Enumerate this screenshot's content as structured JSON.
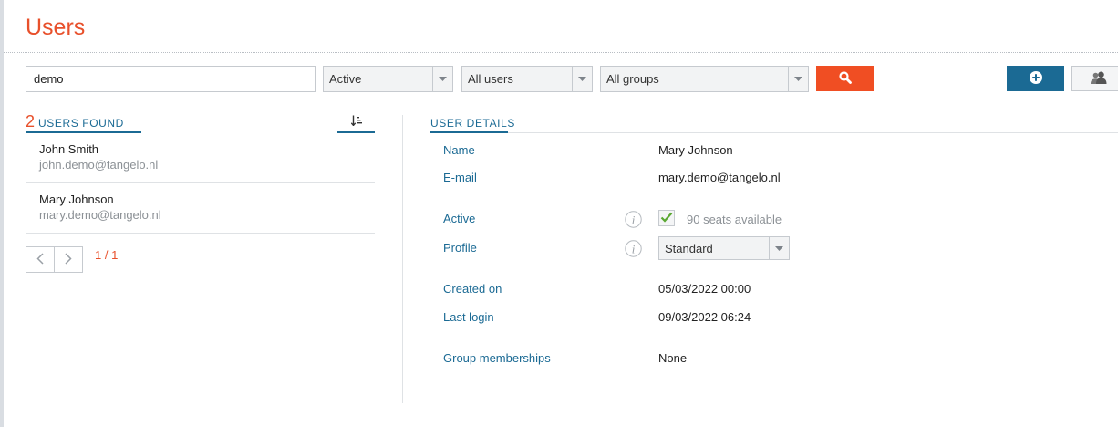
{
  "page": {
    "title": "Users"
  },
  "toolbar": {
    "search_value": "demo",
    "status_filter": "Active",
    "users_filter": "All users",
    "groups_filter": "All groups"
  },
  "results": {
    "count": "2",
    "label": "USERS FOUND",
    "users": [
      {
        "name": "John Smith",
        "email": "john.demo@tangelo.nl"
      },
      {
        "name": "Mary Johnson",
        "email": "mary.demo@tangelo.nl"
      }
    ],
    "pagination": {
      "current": "1",
      "separator": "/",
      "total": "1"
    }
  },
  "details": {
    "header": "USER DETAILS",
    "name_label": "Name",
    "name_value": "Mary Johnson",
    "email_label": "E-mail",
    "email_value": "mary.demo@tangelo.nl",
    "active_label": "Active",
    "active_checked": true,
    "seats_text": "90 seats available",
    "profile_label": "Profile",
    "profile_value": "Standard",
    "created_label": "Created on",
    "created_value": "05/03/2022 00:00",
    "lastlogin_label": "Last login",
    "lastlogin_value": "09/03/2022 06:24",
    "groups_label": "Group memberships",
    "groups_value": "None"
  },
  "icons": {
    "search": "search-icon",
    "add": "plus-circle-icon",
    "groups": "users-group-icon",
    "sort": "sort-icon",
    "prev": "chevron-left-icon",
    "next": "chevron-right-icon",
    "info": "info-icon",
    "check": "checkmark-icon",
    "dropdown": "chevron-down-icon"
  },
  "colors": {
    "accent": "#e8502b",
    "primary": "#1b6a94",
    "search_button": "#f04e23",
    "check": "#5aa832"
  }
}
